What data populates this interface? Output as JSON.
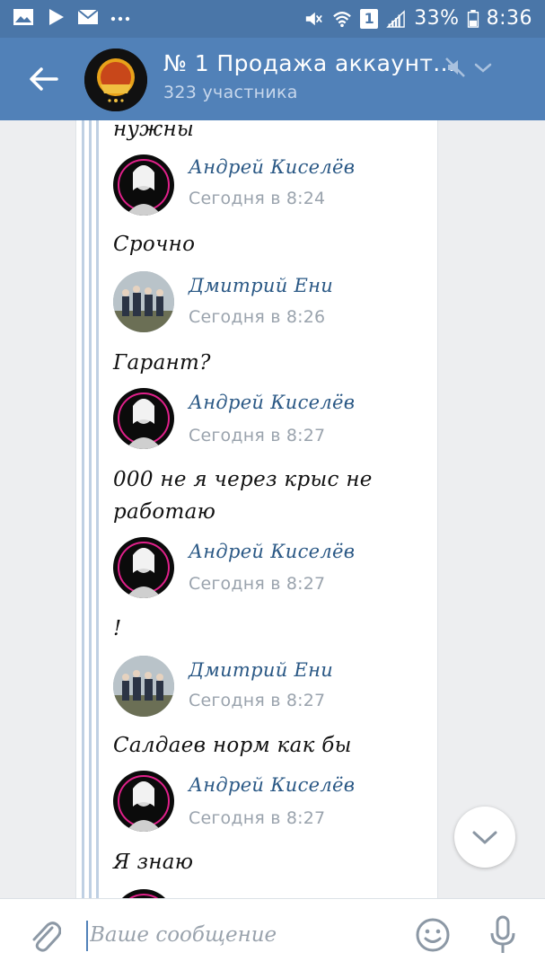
{
  "status_bar": {
    "battery_percent": "33%",
    "time": "8:36",
    "sim_badge": "1",
    "icons": [
      "gallery-icon",
      "play-store-icon",
      "mail-icon",
      "more-icon",
      "mute-icon",
      "wifi-icon",
      "signal-icon",
      "battery-icon"
    ]
  },
  "header": {
    "title": "№ 1 Продажа аккаунт...",
    "subtitle": "323 участника",
    "icons": [
      "back-arrow-icon",
      "muted-bell-icon",
      "chevron-down-icon"
    ]
  },
  "chat": {
    "partial_top_text": "нужны",
    "entries": [
      {
        "author": "Андрей Киселёв",
        "time": "Сегодня в 8:24",
        "text_lines": [
          "Срочно"
        ],
        "avatar": "andrey"
      },
      {
        "author": "Дмитрий Ени",
        "time": "Сегодня в 8:26",
        "text_lines": [
          "Гарант?"
        ],
        "avatar": "dmitry"
      },
      {
        "author": "Андрей Киселёв",
        "time": "Сегодня в 8:27",
        "text_lines": [
          "000 не я через крыс не",
          "работаю"
        ],
        "avatar": "andrey"
      },
      {
        "author": "Андрей Киселёв",
        "time": "Сегодня в 8:27",
        "text_lines": [
          "!"
        ],
        "avatar": "andrey"
      },
      {
        "author": "Дмитрий Ени",
        "time": "Сегодня в 8:27",
        "text_lines": [
          "Салдаев норм как бы"
        ],
        "avatar": "dmitry"
      },
      {
        "author": "Андрей Киселёв",
        "time": "Сегодня в 8:27",
        "text_lines": [
          "Я знаю"
        ],
        "avatar": "andrey"
      }
    ]
  },
  "composer": {
    "placeholder": "Ваше сообщение",
    "value": ""
  },
  "colors": {
    "header_bg": "#5181b8",
    "status_bg": "#4a76a8",
    "author": "#2a5885",
    "quote_line": "#bfd0e3"
  }
}
